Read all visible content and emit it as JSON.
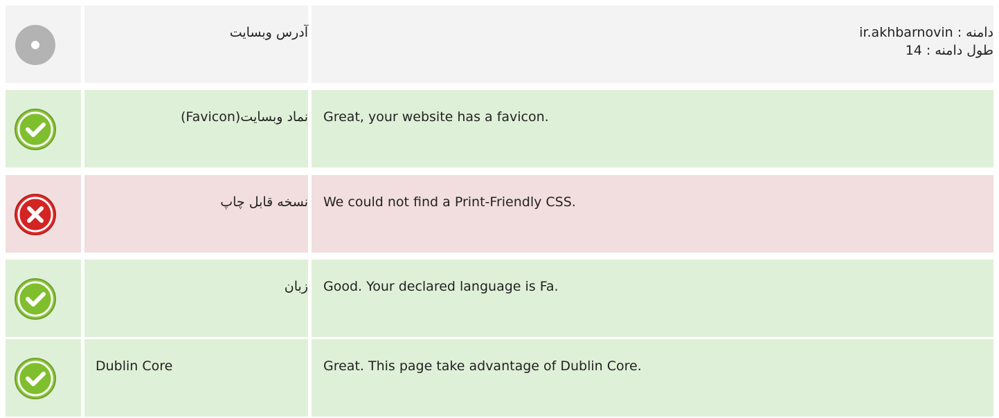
{
  "colors": {
    "neutral_bg": "#f3f3f3",
    "pass_bg": "#dff0d8",
    "fail_bg": "#f2dede",
    "pass_icon": "#8dc63f",
    "fail_icon": "#e02b2b",
    "neutral_icon": "#b3b3b3"
  },
  "rows": [
    {
      "status": "neutral",
      "icon": "neutral-dot-icon",
      "label": "آدرس وبسایت",
      "lines": [
        "دامنه : ir.akhbarnovin",
        "طول دامنه : 14"
      ]
    },
    {
      "status": "pass",
      "icon": "check-icon",
      "label": "نماد وبسایت(Favicon)",
      "lines": [
        "Great, your website has a favicon."
      ]
    },
    {
      "status": "fail",
      "icon": "cross-icon",
      "label": "نسخه قابل چاپ",
      "lines": [
        "We could not find a Print-Friendly CSS."
      ]
    },
    {
      "status": "pass",
      "icon": "check-icon",
      "label": "زبان",
      "lines": [
        "Good. Your declared language is Fa."
      ]
    },
    {
      "status": "pass",
      "icon": "check-icon",
      "label": "Dublin Core",
      "lines": [
        "Great. This page take advantage of Dublin Core."
      ]
    }
  ]
}
